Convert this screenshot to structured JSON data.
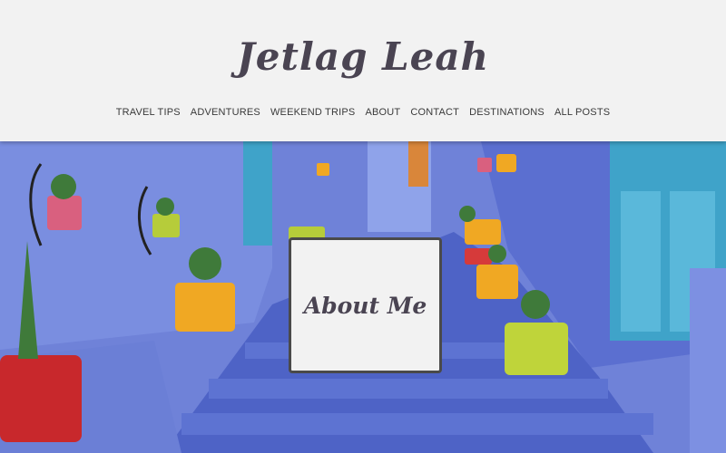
{
  "site": {
    "title": "Jetlag Leah"
  },
  "nav": {
    "items": [
      {
        "label": "TRAVEL TIPS"
      },
      {
        "label": "ADVENTURES"
      },
      {
        "label": "WEEKEND TRIPS"
      },
      {
        "label": "ABOUT"
      },
      {
        "label": "CONTACT"
      },
      {
        "label": "DESTINATIONS"
      },
      {
        "label": "ALL POSTS"
      }
    ]
  },
  "hero": {
    "overlay_label": "About Me"
  },
  "colors": {
    "header_bg": "#f2f2f2",
    "title_text": "#4a4452",
    "wall_blue": "#6b7fd6",
    "door_teal": "#3fa3c9"
  }
}
